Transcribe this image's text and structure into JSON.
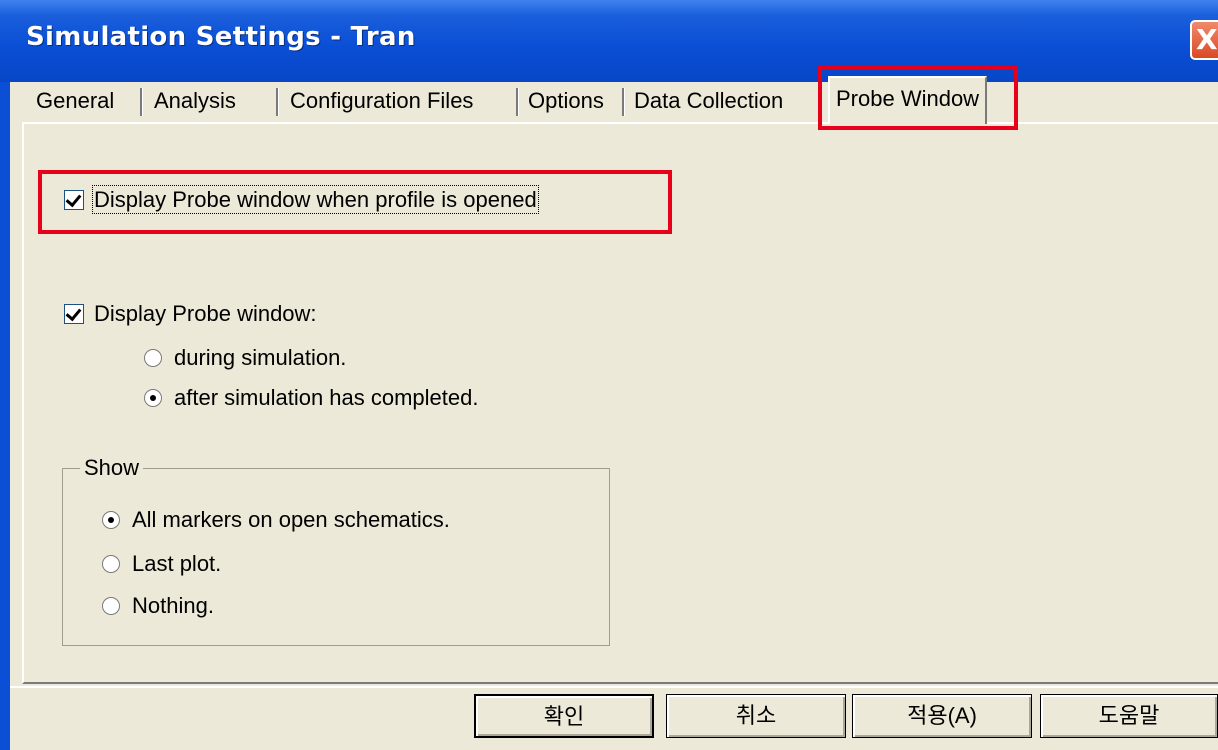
{
  "window": {
    "title": "Simulation Settings - Tran",
    "close_label": "X"
  },
  "tabs": [
    {
      "label": "General",
      "selected": false
    },
    {
      "label": "Analysis",
      "selected": false
    },
    {
      "label": "Configuration Files",
      "selected": false
    },
    {
      "label": "Options",
      "selected": false
    },
    {
      "label": "Data Collection",
      "selected": false
    },
    {
      "label": "Probe Window",
      "selected": true
    }
  ],
  "probe": {
    "open_profile_label": "Display Probe window when profile is opened",
    "open_profile_checked": true,
    "display_label": "Display Probe window:",
    "display_checked": true,
    "timing_options": [
      {
        "label": "during simulation.",
        "selected": false
      },
      {
        "label": "after simulation has completed.",
        "selected": true
      }
    ]
  },
  "show_group": {
    "title": "Show",
    "options": [
      {
        "label": "All markers on open schematics.",
        "selected": true
      },
      {
        "label": "Last plot.",
        "selected": false
      },
      {
        "label": "Nothing.",
        "selected": false
      }
    ]
  },
  "buttons": {
    "ok": "확인",
    "cancel": "취소",
    "apply": "적용(A)",
    "help": "도움말"
  },
  "colors": {
    "title_bar": "#0a4fd6",
    "dialog_bg": "#ece9d8",
    "highlight": "#e8001a"
  }
}
